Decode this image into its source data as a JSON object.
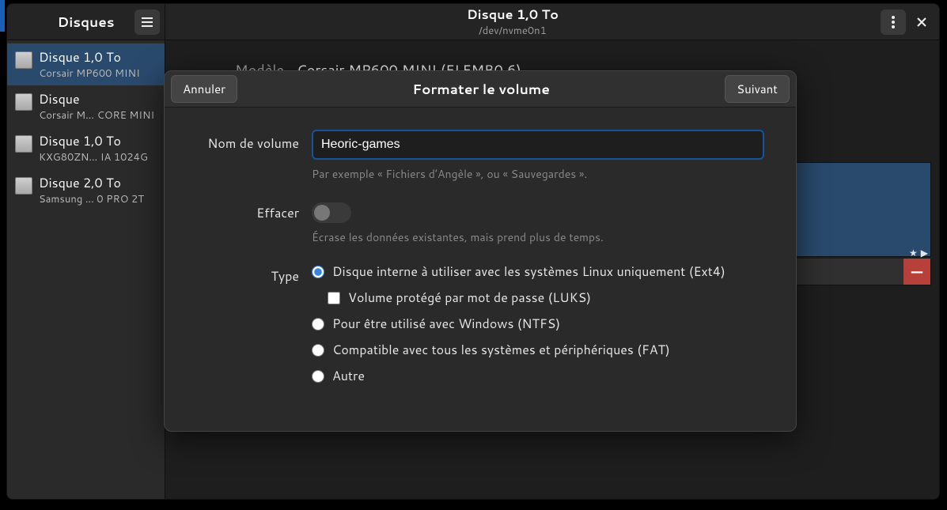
{
  "header": {
    "app_title": "Disques",
    "disk_title": "Disque 1,0 To",
    "disk_subtitle": "/dev/nvme0n1"
  },
  "sidebar": {
    "items": [
      {
        "title": "Disque 1,0 To",
        "subtitle": "Corsair MP600 MINI"
      },
      {
        "title": "Disque",
        "subtitle": "Corsair M… CORE MINI"
      },
      {
        "title": "Disque 1,0 To",
        "subtitle": "KXG80ZN…  IA 1024G"
      },
      {
        "title": "Disque 2,0 To",
        "subtitle": "Samsung …  0 PRO 2T"
      }
    ]
  },
  "content": {
    "model_label": "Modèle",
    "model_value": "Corsair MP600 MINI (ELFMB0.6)",
    "star": "★",
    "play": "▶",
    "minus": "—"
  },
  "dialog": {
    "title": "Formater le volume",
    "cancel": "Annuler",
    "next": "Suivant",
    "name_label": "Nom de volume",
    "name_value": "Heoric-games",
    "name_hint": "Par exemple « Fichiers d’Angèle », ou « Sauvegardes ».",
    "erase_label": "Effacer",
    "erase_hint": "Écrase les données existantes, mais prend plus de temps.",
    "type_label": "Type",
    "type_options": {
      "ext4": "Disque interne à utiliser avec les systèmes Linux uniquement (Ext4)",
      "luks": "Volume protégé par mot de passe (LUKS)",
      "ntfs": "Pour être utilisé avec Windows (NTFS)",
      "fat": "Compatible avec tous les systèmes et périphériques (FAT)",
      "other": "Autre"
    }
  }
}
